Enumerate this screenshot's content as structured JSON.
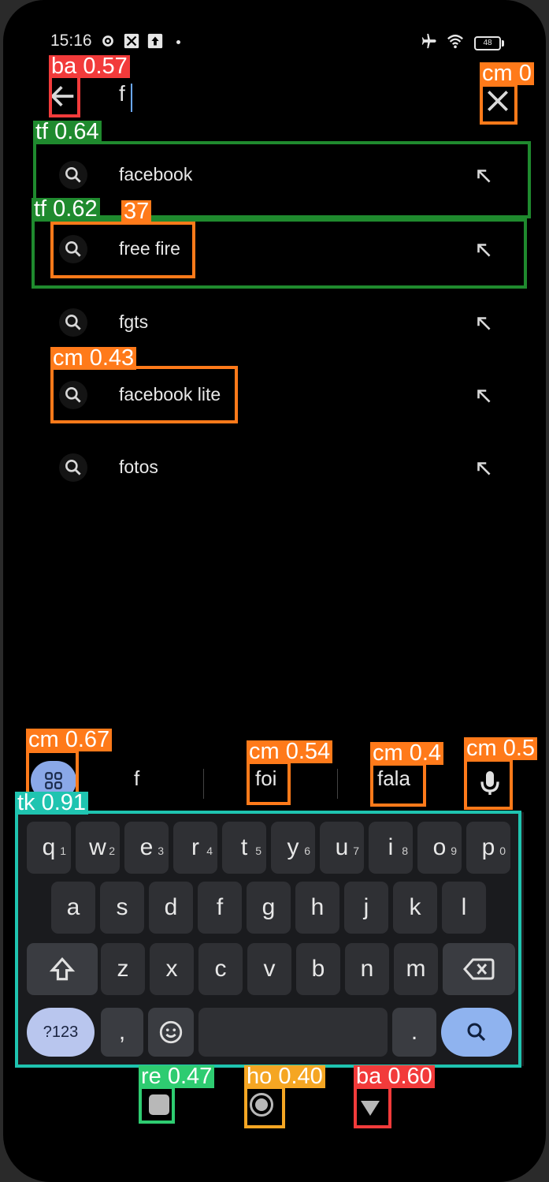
{
  "status_bar": {
    "time": "15:16",
    "battery": "48",
    "icons": [
      "settings-gear-icon",
      "app-notification-icon",
      "app-notification-icon-2",
      "dot-icon",
      "airplane-mode-icon",
      "wifi-icon",
      "battery-icon"
    ]
  },
  "search": {
    "query": "f",
    "back_icon": "arrow-left-icon",
    "clear_icon": "close-icon"
  },
  "suggestions": [
    {
      "text": "facebook",
      "icon": "search-icon",
      "action_icon": "arrow-up-left-icon"
    },
    {
      "text": "free fire",
      "icon": "search-icon",
      "action_icon": "arrow-up-left-icon"
    },
    {
      "text": "fgts",
      "icon": "search-icon",
      "action_icon": "arrow-up-left-icon"
    },
    {
      "text": "facebook lite",
      "icon": "search-icon",
      "action_icon": "arrow-up-left-icon"
    },
    {
      "text": "fotos",
      "icon": "search-icon",
      "action_icon": "arrow-up-left-icon"
    }
  ],
  "keyboard_suggestions": {
    "apps_icon": "grid-icon",
    "words": [
      "f",
      "foi",
      "fala"
    ],
    "mic_icon": "microphone-icon"
  },
  "keyboard": {
    "row1": [
      {
        "key": "q",
        "hint": "1"
      },
      {
        "key": "w",
        "hint": "2"
      },
      {
        "key": "e",
        "hint": "3"
      },
      {
        "key": "r",
        "hint": "4"
      },
      {
        "key": "t",
        "hint": "5"
      },
      {
        "key": "y",
        "hint": "6"
      },
      {
        "key": "u",
        "hint": "7"
      },
      {
        "key": "i",
        "hint": "8"
      },
      {
        "key": "o",
        "hint": "9"
      },
      {
        "key": "p",
        "hint": "0"
      }
    ],
    "row2": [
      "a",
      "s",
      "d",
      "f",
      "g",
      "h",
      "j",
      "k",
      "l"
    ],
    "row3": [
      "z",
      "x",
      "c",
      "v",
      "b",
      "n",
      "m"
    ],
    "symbols_label": "?123",
    "comma": ",",
    "period": ".",
    "shift_icon": "shift-icon",
    "backspace_icon": "backspace-icon",
    "emoji_icon": "emoji-icon",
    "enter_icon": "search-icon"
  },
  "nav_bar": {
    "recents_icon": "square-icon",
    "home_icon": "circle-icon",
    "back_icon": "triangle-down-icon"
  },
  "detections": [
    {
      "label": "ba 0.57",
      "color": "#f23b3b"
    },
    {
      "label": "cm 0",
      "color": "#ff7a1a"
    },
    {
      "label": "tf 0.64",
      "color": "#1f8a2e"
    },
    {
      "label": "tf 0.62",
      "color": "#1f8a2e"
    },
    {
      "label": "37",
      "color": "#ff7a1a"
    },
    {
      "label": "cm 0.43",
      "color": "#ff7a1a"
    },
    {
      "label": "cm 0.67",
      "color": "#ff7a1a"
    },
    {
      "label": "cm 0.54",
      "color": "#ff7a1a"
    },
    {
      "label": "cm 0.4",
      "color": "#ff7a1a"
    },
    {
      "label": "cm 0.5",
      "color": "#ff7a1a"
    },
    {
      "label": "tk 0.91",
      "color": "#1fc4b0"
    },
    {
      "label": "re 0.47",
      "color": "#2ecc71"
    },
    {
      "label": "ho 0.40",
      "color": "#f5a623"
    },
    {
      "label": "ba 0.60",
      "color": "#f23b3b"
    }
  ]
}
